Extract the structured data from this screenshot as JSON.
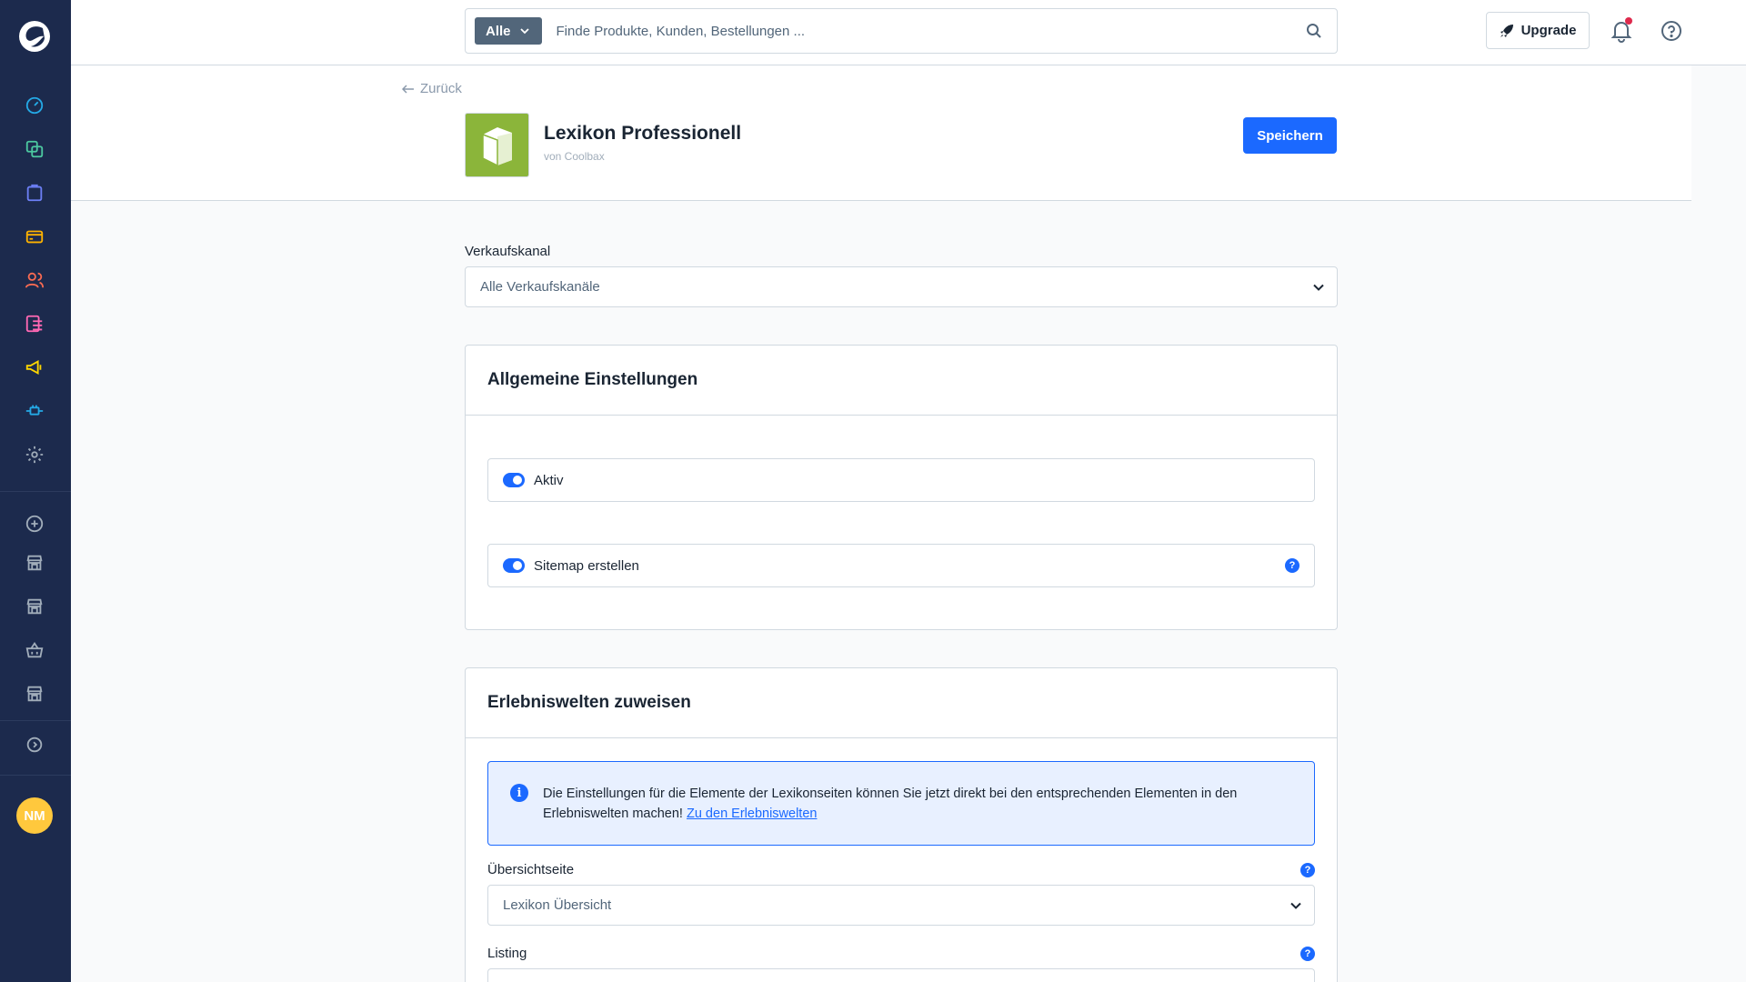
{
  "search": {
    "type_label": "Alle",
    "placeholder": "Finde Produkte, Kunden, Bestellungen ..."
  },
  "topbar": {
    "upgrade_label": "Upgrade"
  },
  "user": {
    "initials": "NM"
  },
  "header": {
    "back_label": "Zurück",
    "app_title": "Lexikon Professionell",
    "app_vendor": "von Coolbax",
    "save_label": "Speichern"
  },
  "sales_channel": {
    "label": "Verkaufskanal",
    "value": "Alle Verkaufskanäle"
  },
  "general_settings": {
    "title": "Allgemeine Einstellungen",
    "active_label": "Aktiv",
    "active_value": true,
    "sitemap_label": "Sitemap erstellen",
    "sitemap_value": true
  },
  "experience_worlds": {
    "title": "Erlebniswelten zuweisen",
    "alert_text": "Die Einstellungen für die Elemente der Lexikonseiten können Sie jetzt direkt bei den entsprechenden Elementen in den Erlebniswelten machen! ",
    "alert_link": "Zu den Erlebniswelten",
    "overview_label": "Übersichtseite",
    "overview_value": "Lexikon Übersicht",
    "listing_label": "Listing"
  },
  "colors": {
    "sidebar": "#1c2a4d",
    "primary": "#1b69ff",
    "app_icon": "#8bb53a",
    "avatar": "#ffc83d"
  },
  "help_glyph": "?"
}
